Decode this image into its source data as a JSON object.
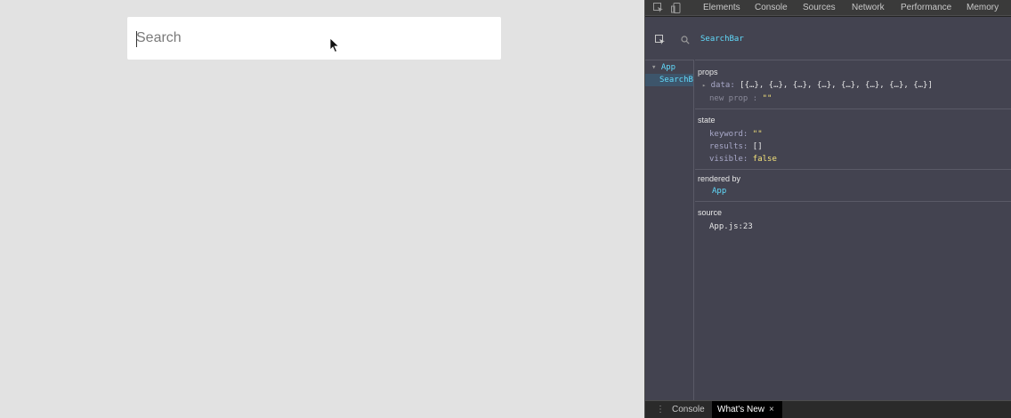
{
  "app": {
    "search": {
      "placeholder": "Search",
      "value": ""
    }
  },
  "devtools": {
    "tabs": [
      "Elements",
      "Console",
      "Sources",
      "Network",
      "Performance",
      "Memory"
    ],
    "component_tree": {
      "items": [
        {
          "label": "App",
          "expanded": true
        },
        {
          "label": "SearchB",
          "selected": true
        }
      ]
    },
    "selected_component": "SearchBar",
    "props": {
      "title": "props",
      "data_key": "data:",
      "data_value": "[{…}, {…}, {…}, {…}, {…}, {…}, {…}, {…}]",
      "new_prop_label": "new prop :",
      "new_prop_value": "\"\""
    },
    "state": {
      "title": "state",
      "items": [
        {
          "key": "keyword:",
          "value": "\"\""
        },
        {
          "key": "results:",
          "value": "[]"
        },
        {
          "key": "visible:",
          "value": "false"
        }
      ]
    },
    "rendered_by": {
      "title": "rendered by",
      "value": "App"
    },
    "source": {
      "title": "source",
      "value": "App.js:23"
    },
    "drawer_tabs": [
      {
        "label": "Console",
        "active": false
      },
      {
        "label": "What's New",
        "active": true,
        "close": "×"
      }
    ],
    "drawer_menu": "⋮"
  }
}
